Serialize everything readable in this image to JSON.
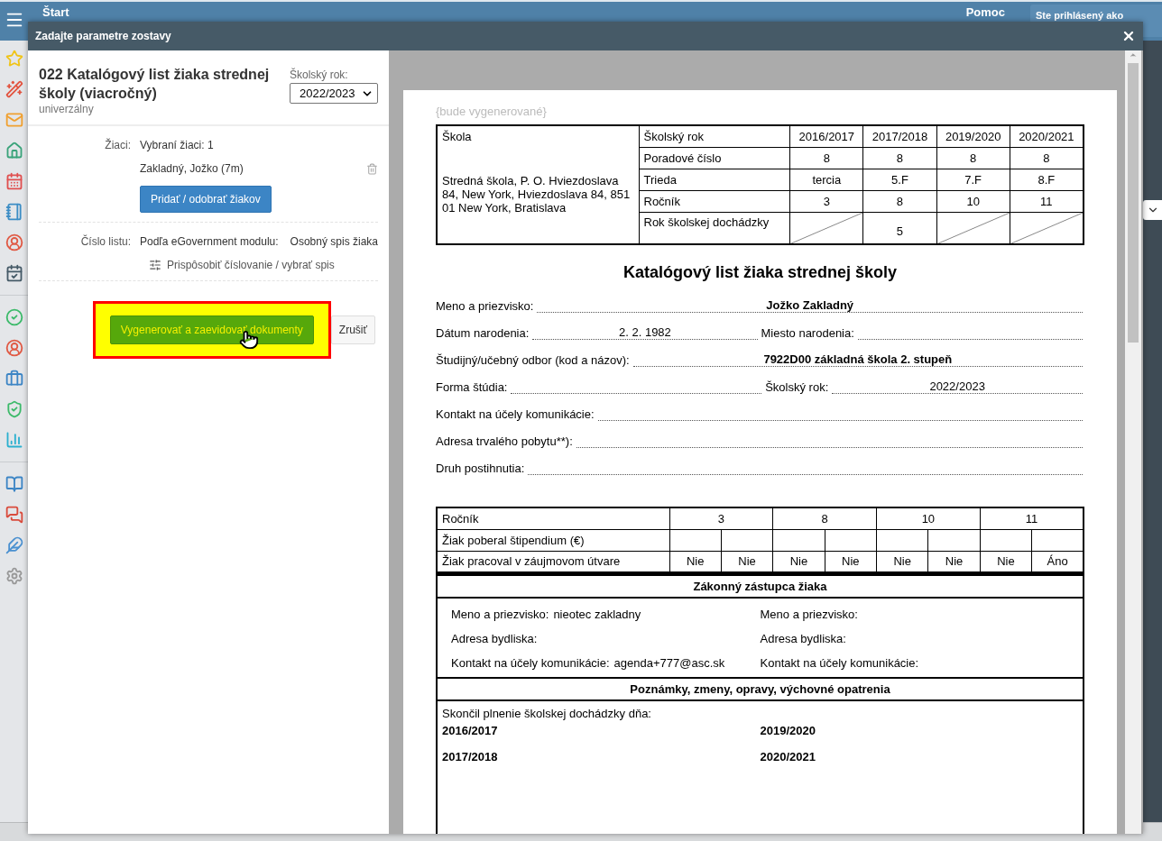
{
  "app_bar": {
    "title": "Štart",
    "help": "Pomoc",
    "user_label": "Ste prihlásený ako"
  },
  "dialog": {
    "title": "Zadajte parametre zostavy"
  },
  "report": {
    "title": "022 Katalógový list žiaka strednej školy (viacročný)",
    "subtitle": "univerzálny",
    "year_label": "Školský rok:",
    "year_value": "2022/2023"
  },
  "students": {
    "label": "Žiaci:",
    "summary": "Vybraní žiaci: 1",
    "items": [
      "Zakladný, Jožko (7m)"
    ],
    "button": "Pridať / odobrať žiakov"
  },
  "sheet_number": {
    "label": "Číslo listu:",
    "source": "Podľa eGovernment modulu:",
    "value": "Osobný spis žiaka",
    "customize_link": "Prispôsobiť číslovanie / vybrať spis"
  },
  "actions": {
    "generate": "Vygenerovať a zaevidovať dokumenty",
    "cancel": "Zrušiť",
    "highlighted": true
  },
  "preview": {
    "placeholder": "{bude vygenerované}",
    "school_table": {
      "school_label": "Škola",
      "school_address": "Stredná škola, P. O. Hviezdoslava 84, New York, Hviezdoslava 84, 851 01 New York, Bratislava",
      "header_label": "Školský rok",
      "years": [
        "2016/2017",
        "2017/2018",
        "2019/2020",
        "2020/2021"
      ],
      "rows": [
        {
          "label": "Poradové číslo",
          "cells": [
            "8",
            "8",
            "8",
            "8"
          ]
        },
        {
          "label": "Trieda",
          "cells": [
            "tercia",
            "5.F",
            "7.F",
            "8.F"
          ]
        },
        {
          "label": "Ročník",
          "cells": [
            "3",
            "8",
            "10",
            "11"
          ]
        },
        {
          "label": "Rok školskej dochádzky",
          "cells": [
            {
              "kind": "crossed"
            },
            "5",
            {
              "kind": "crossed"
            },
            {
              "kind": "crossed"
            }
          ]
        }
      ]
    },
    "doc_title": "Katalógový list žiaka strednej školy",
    "fields": [
      [
        {
          "label": "Meno a priezvisko:",
          "value": "Jožko Zakladný",
          "bold": true
        }
      ],
      [
        {
          "label": "Dátum narodenia:",
          "value": "2. 2. 1982",
          "bold": false
        },
        {
          "label": "Miesto narodenia:"
        }
      ],
      [
        {
          "label": "Študijný/učebný odbor (kod a názov):",
          "value": "7922D00  základná škola 2. stupeň",
          "bold": true
        }
      ],
      [
        {
          "label": "Forma štúdia:"
        },
        {
          "label": "Školský rok:",
          "value": "2022/2023",
          "bold": false
        }
      ],
      [
        {
          "label": "Kontakt na účely komunikácie:"
        }
      ],
      [
        {
          "label": "Adresa trvalého pobytu**):"
        }
      ],
      [
        {
          "label": "Druh postihnutia:"
        }
      ]
    ],
    "activity_table": {
      "header_label": "Ročník",
      "grades": [
        "3",
        "8",
        "10",
        "11"
      ],
      "rows": [
        {
          "label": "Žiak poberal štipendium (€)"
        },
        {
          "label": "Žiak pracoval v záujmovom útvare",
          "cells": [
            "Nie",
            "Nie",
            "Nie",
            "Nie",
            "Nie",
            "Nie",
            "Nie",
            "Áno"
          ]
        }
      ]
    },
    "guardian": {
      "title": "Zákonný zástupca žiaka",
      "columns": [
        [
          {
            "label": "Meno a priezvisko:",
            "value": "nieotec zakladny"
          },
          {
            "label": "Adresa bydliska:"
          },
          {
            "label": "Kontakt na účely komunikácie:",
            "value": "agenda+777@asc.sk"
          }
        ],
        [
          {
            "label": "Meno a priezvisko:"
          },
          {
            "label": "Adresa bydliska:"
          },
          {
            "label": "Kontakt na účely komunikácie:"
          }
        ]
      ]
    },
    "notes": {
      "title": "Poznámky, zmeny, opravy, výchovné opatrenia",
      "intro": "Skončil plnenie školskej dochádzky dňa:",
      "years": [
        "2016/2017",
        "2019/2020",
        "2017/2018",
        "2020/2021"
      ]
    }
  }
}
